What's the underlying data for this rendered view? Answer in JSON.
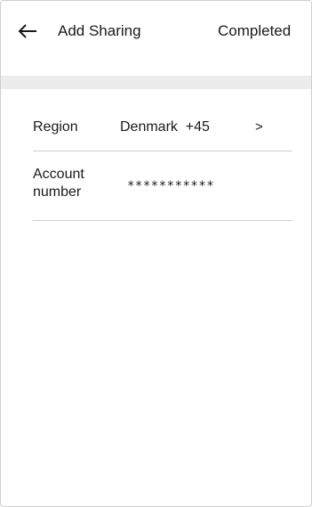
{
  "header": {
    "back_icon": "left-arrow-icon",
    "title": "Add Sharing",
    "action_label": "Completed"
  },
  "form": {
    "region": {
      "label": "Region",
      "value": "Denmark  +45",
      "chevron": ">"
    },
    "account": {
      "label_line1": "Account",
      "label_line2": "number",
      "value": "***********"
    }
  }
}
